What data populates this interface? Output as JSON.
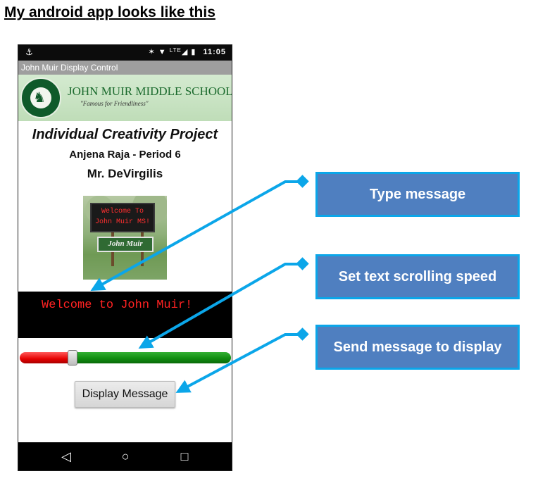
{
  "heading": "My android app looks like this",
  "phone": {
    "status_bar": {
      "left_icon": "android-debug-icon",
      "lte_label": "LTE",
      "time": "11:05"
    },
    "app_bar_title": "John Muir Display Control",
    "banner": {
      "school_name": "JOHN MUIR MIDDLE SCHOOL",
      "motto": "\"Famous for Friendliness\""
    },
    "project_title": "Individual Creativity Project",
    "student_line": "Anjena Raja - Period 6",
    "teacher_line": "Mr. DeVirgilis",
    "sign_photo": {
      "board_text": "Welcome To\nJohn Muir MS!",
      "plaque_text": "John Muir"
    },
    "message_display_text": "Welcome to John Muir!",
    "speed_slider": {
      "value_fraction": 0.25
    },
    "display_button_label": "Display Message",
    "nav": {
      "back_icon": "back-triangle-icon",
      "home_icon": "home-circle-icon",
      "recents_icon": "recents-square-icon"
    }
  },
  "callouts": {
    "type_message": "Type message",
    "scroll_speed": "Set text scrolling speed",
    "send_message": "Send message to display"
  },
  "colors": {
    "callout_fill": "#4f7fc0",
    "callout_border": "#0ba6e9",
    "arrow": "#0ba6e9",
    "message_text": "#ff2222"
  }
}
